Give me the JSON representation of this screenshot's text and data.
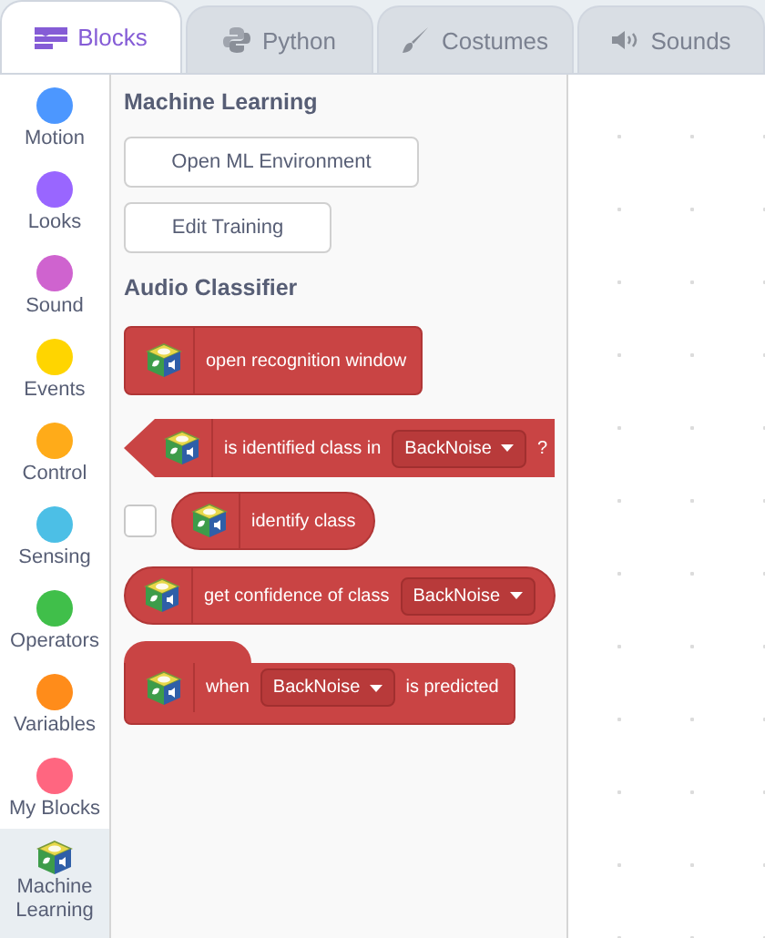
{
  "tabs": [
    {
      "label": "Blocks",
      "selected": true
    },
    {
      "label": "Python",
      "selected": false
    },
    {
      "label": "Costumes",
      "selected": false
    },
    {
      "label": "Sounds",
      "selected": false
    }
  ],
  "categories": [
    {
      "label": "Motion",
      "color": "#4c97ff",
      "selected": false
    },
    {
      "label": "Looks",
      "color": "#9966ff",
      "selected": false
    },
    {
      "label": "Sound",
      "color": "#cf63cf",
      "selected": false
    },
    {
      "label": "Events",
      "color": "#ffd500",
      "selected": false
    },
    {
      "label": "Control",
      "color": "#ffab19",
      "selected": false
    },
    {
      "label": "Sensing",
      "color": "#4cbfe6",
      "selected": false
    },
    {
      "label": "Operators",
      "color": "#40bf4a",
      "selected": false
    },
    {
      "label": "Variables",
      "color": "#ff8c1a",
      "selected": false
    },
    {
      "label": "My Blocks",
      "color": "#ff6680",
      "selected": false
    },
    {
      "label": "Machine Learning",
      "kind": "extension",
      "selected": true
    }
  ],
  "palette": {
    "heading": "Machine Learning",
    "buttons": [
      "Open ML Environment",
      "Edit Training"
    ],
    "subheading": "Audio Classifier",
    "blocks": [
      {
        "kind": "command",
        "parts": [
          {
            "kind": "label",
            "text": "open recognition window"
          }
        ]
      },
      {
        "kind": "boolean",
        "parts": [
          {
            "kind": "label",
            "text": "is identified class in"
          },
          {
            "kind": "dropdown",
            "text": "BackNoise"
          },
          {
            "kind": "label",
            "text": "?"
          }
        ]
      },
      {
        "kind": "reporter",
        "checked": false,
        "parts": [
          {
            "kind": "label",
            "text": "identify class"
          }
        ]
      },
      {
        "kind": "reporter",
        "parts": [
          {
            "kind": "label",
            "text": "get confidence of class"
          },
          {
            "kind": "dropdown",
            "text": "BackNoise"
          }
        ]
      },
      {
        "kind": "hat",
        "parts": [
          {
            "kind": "label",
            "text": "when"
          },
          {
            "kind": "dropdown",
            "text": "BackNoise"
          },
          {
            "kind": "label",
            "text": "is predicted"
          }
        ]
      }
    ]
  }
}
